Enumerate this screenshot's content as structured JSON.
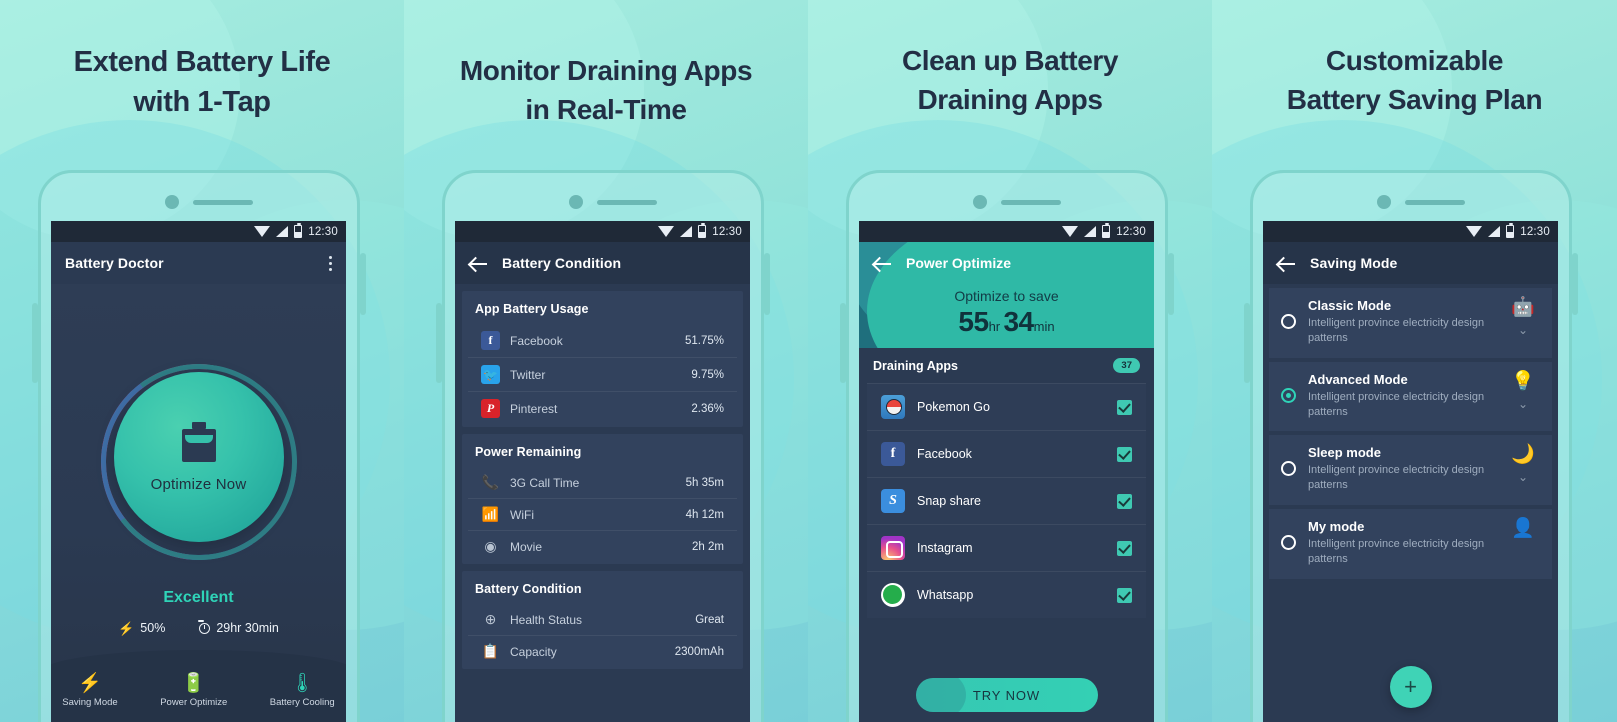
{
  "status_bar": {
    "time": "12:30",
    "icons": [
      "wifi-icon",
      "signal-icon",
      "battery-icon"
    ]
  },
  "colors": {
    "accent": "#2fd4b8",
    "mint_bg": "#8fe0d6",
    "screen_bg": "#2b3a52",
    "card_bg": "#32425d",
    "badge": "#3fc9b2"
  },
  "panels": [
    {
      "headline": "Extend Battery Life\nwith 1-Tap",
      "app_title": "Battery Doctor",
      "menu_icon": "overflow-menu-icon",
      "optimize_button_label": "Optimize Now",
      "rating": "Excellent",
      "metrics": [
        {
          "icon": "bolt-icon",
          "value": "50%"
        },
        {
          "icon": "timer-icon",
          "value": "29hr 30min"
        }
      ],
      "nav_items": [
        {
          "icon": "sliders-bolt-icon",
          "label": "Saving Mode"
        },
        {
          "icon": "battery-up-icon",
          "label": "Power Optimize"
        },
        {
          "icon": "thermometer-icon",
          "label": "Battery Cooling"
        }
      ]
    },
    {
      "headline": "Monitor Draining Apps\nin Real-Time",
      "app_title": "Battery Condition",
      "back_icon": "back-arrow-icon",
      "sections": [
        {
          "title": "App Battery Usage",
          "rows": [
            {
              "icon": "facebook-icon",
              "name": "Facebook",
              "value": "51.75%"
            },
            {
              "icon": "twitter-icon",
              "name": "Twitter",
              "value": "9.75%"
            },
            {
              "icon": "pinterest-icon",
              "name": "Pinterest",
              "value": "2.36%"
            }
          ]
        },
        {
          "title": "Power Remaining",
          "rows": [
            {
              "icon": "phone-3g-icon",
              "name": "3G Call Time",
              "value": "5h 35m"
            },
            {
              "icon": "wifi-icon",
              "name": "WiFi",
              "value": "4h 12m"
            },
            {
              "icon": "film-reel-icon",
              "name": "Movie",
              "value": "2h 2m"
            }
          ]
        },
        {
          "title": "Battery Condition",
          "rows": [
            {
              "icon": "plus-circle-icon",
              "name": "Health Status",
              "value": "Great"
            },
            {
              "icon": "clipboard-icon",
              "name": "Capacity",
              "value": "2300mAh"
            }
          ]
        }
      ]
    },
    {
      "headline": "Clean up Battery\nDraining Apps",
      "app_title": "Power Optimize",
      "back_icon": "back-arrow-icon",
      "hero": {
        "caption": "Optimize to save",
        "hours": "55",
        "hours_unit": "hr",
        "minutes": "34",
        "minutes_unit": "min"
      },
      "list_title": "Draining Apps",
      "list_badge": "37",
      "apps": [
        {
          "icon": "pokemon-go-icon",
          "name": "Pokemon Go",
          "checked": true
        },
        {
          "icon": "facebook-icon",
          "name": "Facebook",
          "checked": true
        },
        {
          "icon": "snapshare-icon",
          "name": "Snap share",
          "checked": true
        },
        {
          "icon": "instagram-icon",
          "name": "Instagram",
          "checked": true
        },
        {
          "icon": "whatsapp-icon",
          "name": "Whatsapp",
          "checked": true
        }
      ],
      "cta_label": "TRY NOW"
    },
    {
      "headline": "Customizable\nBattery Saving Plan",
      "app_title": "Saving Mode",
      "back_icon": "back-arrow-icon",
      "modes": [
        {
          "title": "Classic Mode",
          "desc": "Intelligent province electricity design patterns",
          "selected": false,
          "icon": "android-robot-icon",
          "chevron": "chevron-down-icon"
        },
        {
          "title": "Advanced Mode",
          "desc": "Intelligent province electricity design patterns",
          "selected": true,
          "icon": "lightbulb-icon",
          "chevron": "chevron-down-icon"
        },
        {
          "title": "Sleep mode",
          "desc": "Intelligent province electricity design patterns",
          "selected": false,
          "icon": "moon-icon",
          "chevron": "chevron-down-icon"
        },
        {
          "title": "My mode",
          "desc": "Intelligent province electricity design patterns",
          "selected": false,
          "icon": "person-icon",
          "chevron": ""
        }
      ],
      "fab_label": "+"
    }
  ]
}
